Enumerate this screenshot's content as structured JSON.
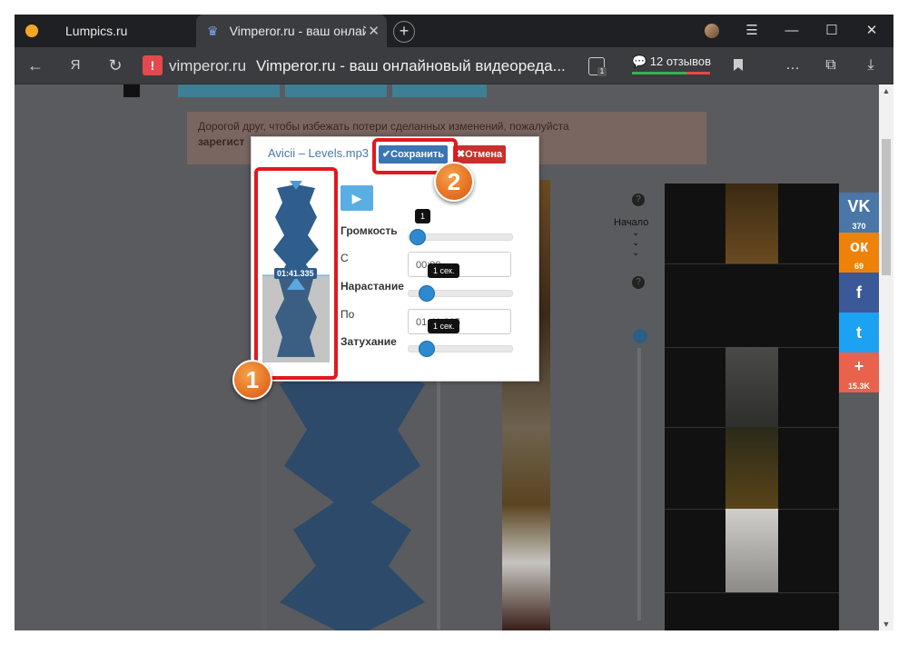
{
  "browser": {
    "tabs": [
      {
        "label": "Lumpics.ru"
      },
      {
        "label": "Vimperor.ru - ваш онлайн"
      }
    ],
    "domain": "vimperor.ru",
    "page_title": "Vimperor.ru - ваш онлайновый видеореда...",
    "reviews": "12 отзывов",
    "shield_count": "1",
    "menu_icon": "hamburger-icon"
  },
  "page": {
    "notice_line1": "Дорогой друг, чтобы избежать потери сделанных изменений, пожалуйста",
    "notice_line2": "зарегист"
  },
  "controls": {
    "start_label": "Начало"
  },
  "dialog": {
    "title": "Avicii – Levels.mp3",
    "save_label": "✔Сохранить",
    "cancel_label": "✖Отмена",
    "waveform_time": "01:41.335",
    "volume_label": "Громкость",
    "volume_value": "1",
    "volume_level": 0.0,
    "from_label": "С",
    "from_value": "00:00",
    "fade_in_label": "Нарастание",
    "fade_in_value": "1 сек.",
    "to_label": "По",
    "to_value": "01:41.335",
    "fade_out_label": "Затухание",
    "fade_out_value": "1 сек."
  },
  "annotations": {
    "badge1": "1",
    "badge2": "2"
  },
  "social": [
    {
      "name": "vk",
      "glyph": "VK",
      "count": "370",
      "color": "#4a76a8"
    },
    {
      "name": "odnoklassniki",
      "glyph": "ок",
      "count": "69",
      "color": "#ee8208"
    },
    {
      "name": "facebook",
      "glyph": "f",
      "count": "",
      "color": "#3b5998"
    },
    {
      "name": "twitter",
      "glyph": "t",
      "count": "",
      "color": "#1da1f2"
    },
    {
      "name": "share-more",
      "glyph": "+",
      "count": "15.3K",
      "color": "#e9624b"
    }
  ]
}
